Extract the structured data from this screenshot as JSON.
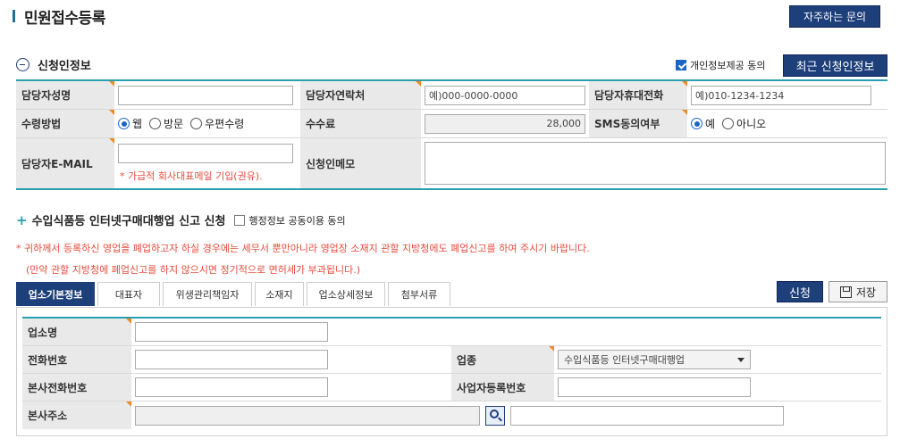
{
  "header": {
    "title": "민원접수등록",
    "faq_button": "자주하는 문의"
  },
  "applicant": {
    "section_title": "신청인정보",
    "consent_label": "개인정보제공 동의",
    "recent_button": "최근 신청인정보",
    "labels": {
      "name": "담당자성명",
      "contact": "담당자연락처",
      "mobile": "담당자휴대전화",
      "receive_method": "수령방법",
      "fee": "수수료",
      "sms": "SMS동의여부",
      "email": "담당자E-MAIL",
      "memo": "신청인메모"
    },
    "contact_placeholder": "예)000-0000-0000",
    "mobile_placeholder": "예)010-1234-1234",
    "receive_options": [
      "웹",
      "방문",
      "우편수령"
    ],
    "fee_value": "28,000",
    "sms_options": [
      "예",
      "아니오"
    ],
    "email_note": "* 가급적 회사대표메일 기입(권유)."
  },
  "report": {
    "section_title": "수입식품등 인터넷구매대행업 신고 신청",
    "share_consent": "행정정보 공동이용 동의",
    "warning_line1": "* 귀하께서 등록하신 영업을 폐업하고자 하실 경우에는 세무서 뿐만아니라 영업장 소재지 관할 지방청에도 폐업신고를 하여 주시기 바랍니다.",
    "warning_line2": "(만약 관할 지방청에 폐업신고를 하지 않으시면 정기적으로 면허세가 부과됩니다.)",
    "tabs": [
      "업소기본정보",
      "대표자",
      "위생관리책임자",
      "소재지",
      "업소상세정보",
      "첨부서류"
    ],
    "apply_button": "신청",
    "save_button": "저장"
  },
  "business": {
    "labels": {
      "name": "업소명",
      "phone": "전화번호",
      "type": "업종",
      "hq_phone": "본사전화번호",
      "biz_reg_no": "사업자등록번호",
      "hq_address": "본사주소"
    },
    "type_value": "수입식품등 인터넷구매대행업"
  }
}
